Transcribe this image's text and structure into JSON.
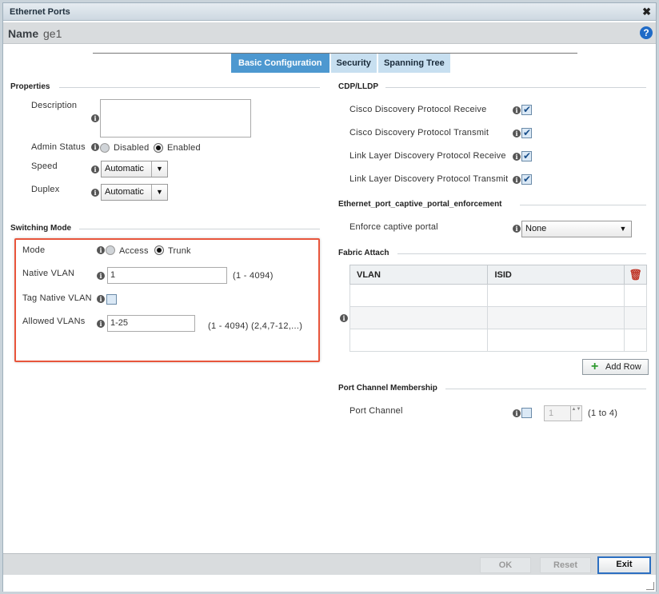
{
  "window": {
    "title": "Ethernet Ports",
    "close_glyph": "✖"
  },
  "name_bar": {
    "label": "Name",
    "value": "ge1",
    "help_glyph": "?"
  },
  "tabs": [
    {
      "label": "Basic Configuration",
      "active": true
    },
    {
      "label": "Security",
      "active": false
    },
    {
      "label": "Spanning Tree",
      "active": false
    }
  ],
  "properties": {
    "title": "Properties",
    "description_label": "Description",
    "admin_status_label": "Admin Status",
    "admin_status_options": [
      "Disabled",
      "Enabled"
    ],
    "admin_status_value": "Enabled",
    "speed_label": "Speed",
    "speed_value": "Automatic",
    "duplex_label": "Duplex",
    "duplex_value": "Automatic"
  },
  "switching": {
    "title": "Switching Mode",
    "mode_label": "Mode",
    "mode_options": [
      "Access",
      "Trunk"
    ],
    "mode_value": "Trunk",
    "native_vlan_label": "Native VLAN",
    "native_vlan_value": "1",
    "native_vlan_range": "(1 - 4094)",
    "tag_native_vlan_label": "Tag Native VLAN",
    "tag_native_vlan_checked": false,
    "allowed_vlans_label": "Allowed VLANs",
    "allowed_vlans_value": "1-25",
    "allowed_vlans_range": "(1 - 4094)  (2,4,7-12,...)"
  },
  "cdp_lldp": {
    "title": "CDP/LLDP",
    "items": [
      {
        "label": "Cisco Discovery Protocol Receive",
        "checked": true
      },
      {
        "label": "Cisco Discovery Protocol Transmit",
        "checked": true
      },
      {
        "label": "Link Layer Discovery Protocol Receive",
        "checked": true
      },
      {
        "label": "Link Layer Discovery Protocol Transmit",
        "checked": true
      }
    ]
  },
  "captive_portal": {
    "title": "Ethernet_port_captive_portal_enforcement",
    "enforce_label": "Enforce captive portal",
    "enforce_value": "None"
  },
  "fabric_attach": {
    "title": "Fabric Attach",
    "columns": [
      "VLAN",
      "ISID"
    ],
    "add_row_label": "Add Row",
    "add_row_glyph": "+",
    "delete_glyph": "🗑"
  },
  "port_channel": {
    "title": "Port Channel Membership",
    "label": "Port Channel",
    "checked": false,
    "value": "1",
    "range": "(1 to 4)"
  },
  "footer": {
    "ok_label": "OK",
    "reset_label": "Reset",
    "exit_label": "Exit"
  },
  "icons": {
    "info_glyph": "i",
    "dropdown_glyph": "▼",
    "spin_glyph": "▲▼"
  },
  "colors": {
    "accent": "#4d98d0",
    "highlight_border": "#e8553b",
    "help": "#1f6bc7"
  }
}
